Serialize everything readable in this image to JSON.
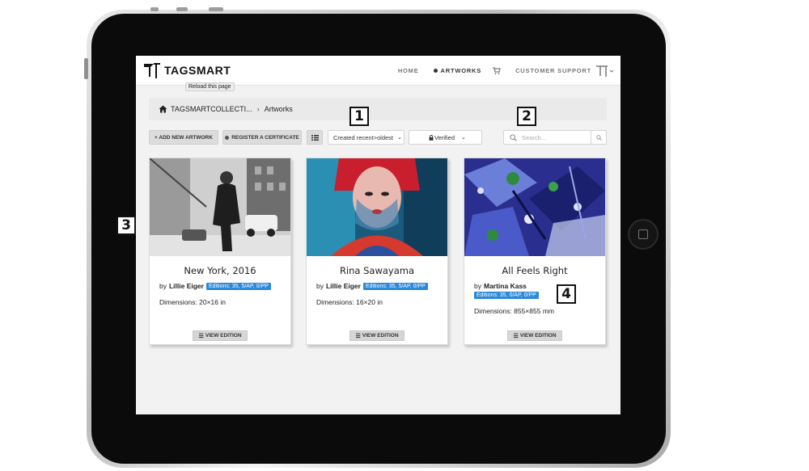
{
  "nav": {
    "brand": "TAGSMART",
    "links": [
      "HOME",
      "ARTWORKS",
      "CUSTOMER SUPPORT"
    ],
    "tooltip": "Reload this page"
  },
  "breadcrumb": {
    "root": "TAGSMARTCOLLECTI...",
    "current": "Artworks"
  },
  "toolbar": {
    "add_artwork": "+ ADD NEW ARTWORK",
    "register_certificate": "REGISTER A CERTIFICATE",
    "sort_value": "Created recent>oldest",
    "filter_value": "Verified",
    "search_placeholder": "Search..."
  },
  "artworks": [
    {
      "title": "New York, 2016",
      "by": "by",
      "artist": "Lillie Eiger",
      "editions": "Editions: 35, 5/AP, 0/PP",
      "dimensions": "Dimensions: 20×16 in",
      "view": "VIEW EDITION"
    },
    {
      "title": "Rina Sawayama",
      "by": "by",
      "artist": "Lillie Eiger",
      "editions": "Editions: 35, 5/AP, 0/PP",
      "dimensions": "Dimensions: 16×20 in",
      "view": "VIEW EDITION"
    },
    {
      "title": "All Feels Right",
      "by": "by",
      "artist": "Martina Kass",
      "editions": "Editions: 35, 0/AP, 0/PP",
      "dimensions": "Dimensions: 855×855 mm",
      "view": "VIEW EDITION"
    }
  ],
  "callouts": [
    "1",
    "2",
    "3",
    "4"
  ],
  "colors": {
    "badge": "#2b88d8",
    "frame": "#0b0b0b"
  }
}
